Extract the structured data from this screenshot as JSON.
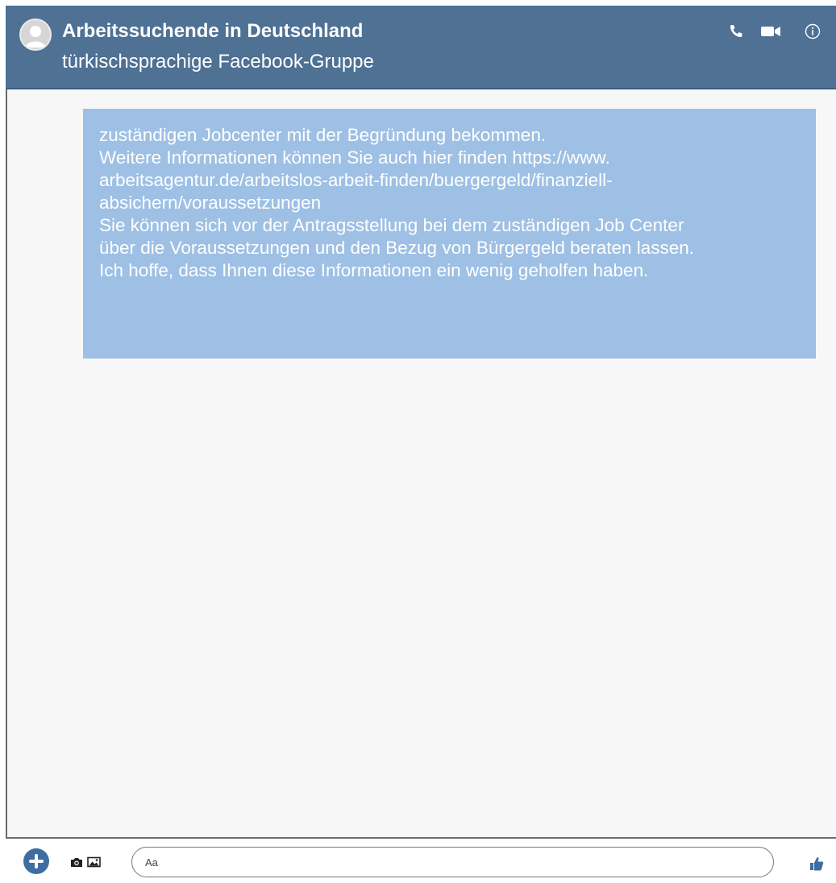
{
  "header": {
    "title": "Arbeitssuchende in Deutschland",
    "subtitle": "türkischsprachige Facebook-Gruppe",
    "icons": [
      "avatar",
      "phone-icon",
      "video-camera-icon",
      "info-icon"
    ]
  },
  "message": {
    "lines": [
      "zuständigen Jobcenter mit der Begründung bekommen.",
      "Weitere Informationen können Sie auch hier finden https://www.",
      "arbeitsagentur.de/arbeitslos-arbeit-finden/buergergeld/finanziell-",
      "absichern/voraussetzungen",
      "Sie können sich vor der Antragsstellung bei dem zuständigen Job Center",
      "über die Voraussetzungen und den Bezug von Bürgergeld beraten lassen.",
      "Ich hoffe, dass Ihnen diese Informationen ein wenig geholfen haben."
    ]
  },
  "composer": {
    "placeholder": "Aa",
    "icons": [
      "add-icon",
      "camera-icon",
      "image-icon",
      "thumbs-up-icon"
    ]
  },
  "colors": {
    "header_bg": "#4e7194",
    "bubble_bg": "#9ec0e4",
    "chat_bg": "#f7f7f7",
    "accent": "#3e6ea1"
  }
}
